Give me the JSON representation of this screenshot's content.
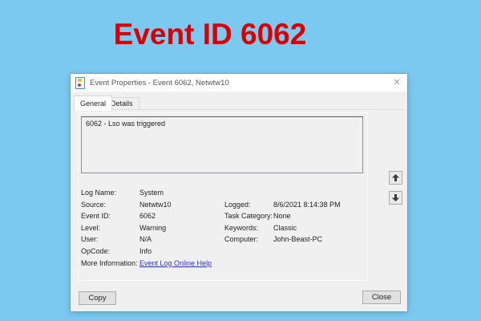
{
  "page": {
    "heading": "Event ID 6062",
    "colors": {
      "background": "#7bc8f0",
      "heading": "#db0000",
      "link": "#3333cc"
    }
  },
  "dialog": {
    "title": "Event Properties - Event 6062, Netwtw10",
    "icons": {
      "close": "✕",
      "app": "event-viewer-log-icon",
      "nav_up": "up-arrow",
      "nav_down": "down-arrow"
    },
    "tabs": [
      {
        "label": "General",
        "active": true
      },
      {
        "label": "Details",
        "active": false
      }
    ],
    "description": "6062 - Lso was triggered",
    "fields_left": [
      {
        "label": "Log Name:",
        "value": "System"
      },
      {
        "label": "Source:",
        "value": "Netwtw10"
      },
      {
        "label": "Event ID:",
        "value": "6062"
      },
      {
        "label": "Level:",
        "value": "Warning"
      },
      {
        "label": "User:",
        "value": "N/A"
      },
      {
        "label": "OpCode:",
        "value": "Info"
      },
      {
        "label": "More Information:",
        "value": "Event Log Online Help"
      }
    ],
    "fields_right": [
      {
        "label": "Logged:",
        "value": "8/6/2021 8:14:38 PM"
      },
      {
        "label": "Task Category:",
        "value": "None"
      },
      {
        "label": "Keywords:",
        "value": "Classic"
      },
      {
        "label": "Computer:",
        "value": "John-Beast-PC"
      }
    ],
    "buttons": {
      "copy": "Copy",
      "close": "Close"
    }
  }
}
